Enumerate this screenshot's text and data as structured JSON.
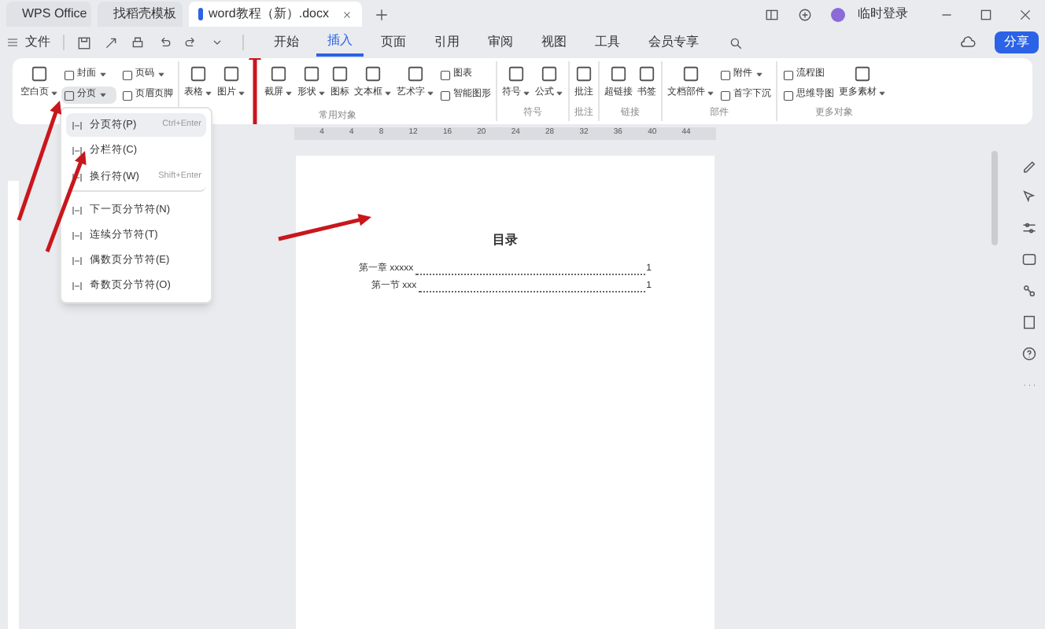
{
  "title_tabs": [
    {
      "label": "WPS Office",
      "selected": false
    },
    {
      "label": "找稻壳模板",
      "selected": false
    },
    {
      "label": "word教程（新）.docx",
      "selected": true
    }
  ],
  "user": {
    "label": "临时登录"
  },
  "menu": {
    "file": "文件",
    "tabs": [
      {
        "label": "开始",
        "selected": false
      },
      {
        "label": "插入",
        "selected": true
      },
      {
        "label": "页面",
        "selected": false
      },
      {
        "label": "引用",
        "selected": false
      },
      {
        "label": "审阅",
        "selected": false
      },
      {
        "label": "视图",
        "selected": false
      },
      {
        "label": "工具",
        "selected": false
      },
      {
        "label": "会员专享",
        "selected": false
      }
    ],
    "share": "分享"
  },
  "ribbon": {
    "groups": [
      {
        "big": [
          {
            "label": "空白页",
            "dropdown": true
          }
        ],
        "small": [
          {
            "label": "封面",
            "dropdown": true,
            "selected": false
          },
          {
            "label": "页码",
            "dropdown": true,
            "selected": false
          },
          {
            "label": "分页",
            "dropdown": true,
            "selected": true
          },
          {
            "label": "页眉页脚",
            "dropdown": false,
            "selected": false
          }
        ]
      },
      {
        "label": "常用对象",
        "big": [
          {
            "label": "表格",
            "dropdown": true
          },
          {
            "label": "图片",
            "dropdown": true
          },
          {
            "label": "截屏",
            "dropdown": true
          },
          {
            "label": "形状",
            "dropdown": true
          },
          {
            "label": "图标",
            "dropdown": false
          },
          {
            "label": "文本框",
            "dropdown": true
          },
          {
            "label": "艺术字",
            "dropdown": true
          }
        ],
        "small": [
          {
            "label": "图表",
            "dropdown": false,
            "selected": false
          },
          {
            "label": "智能图形",
            "dropdown": false,
            "selected": false
          }
        ]
      },
      {
        "label": "符号",
        "big": [
          {
            "label": "符号",
            "dropdown": true
          },
          {
            "label": "公式",
            "dropdown": true
          }
        ]
      },
      {
        "label": "批注",
        "big": [
          {
            "label": "批注",
            "dropdown": false
          }
        ]
      },
      {
        "label": "链接",
        "big": [
          {
            "label": "超链接",
            "dropdown": false
          },
          {
            "label": "书签",
            "dropdown": false
          }
        ]
      },
      {
        "label": "部件",
        "big": [
          {
            "label": "文档部件",
            "dropdown": true
          }
        ],
        "small": [
          {
            "label": "附件",
            "dropdown": true,
            "selected": false
          },
          {
            "label": "首字下沉",
            "dropdown": false,
            "selected": false
          }
        ]
      },
      {
        "label": "更多对象",
        "small": [
          {
            "label": "流程图",
            "dropdown": false,
            "selected": false
          },
          {
            "label": "思维导图",
            "dropdown": false,
            "selected": false
          }
        ],
        "big": [
          {
            "label": "更多素材",
            "dropdown": true
          }
        ]
      }
    ]
  },
  "dropdown_menu": {
    "items": [
      {
        "label": "分页符(P)",
        "shortcut": "Ctrl+Enter",
        "selected": true,
        "divider_after": false
      },
      {
        "label": "分栏符(C)",
        "selected": false,
        "divider_after": false
      },
      {
        "label": "换行符(W)",
        "shortcut": "Shift+Enter",
        "selected": false,
        "divider_after": true
      },
      {
        "label": "下一页分节符(N)",
        "selected": false,
        "divider_after": false
      },
      {
        "label": "连续分节符(T)",
        "selected": false,
        "divider_after": false
      },
      {
        "label": "偶数页分节符(E)",
        "selected": false,
        "divider_after": false
      },
      {
        "label": "奇数页分节符(O)",
        "selected": false,
        "divider_after": false
      }
    ]
  },
  "ruler": {
    "ticks": [
      "4",
      "4",
      "8",
      "12",
      "16",
      "20",
      "24",
      "28",
      "32",
      "36",
      "40",
      "44"
    ]
  },
  "document": {
    "title": "目录",
    "toc": [
      {
        "label": "第一章 xxxxx",
        "page": "1",
        "children": [
          {
            "label": "第一节 xxx",
            "page": "1"
          }
        ]
      }
    ]
  }
}
